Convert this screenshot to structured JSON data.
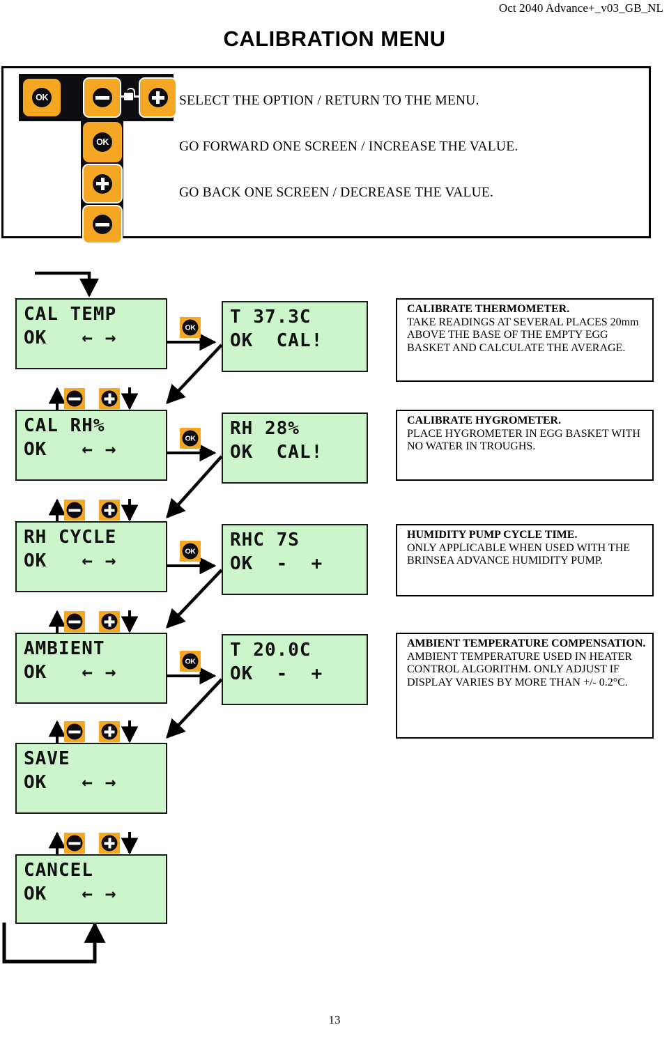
{
  "header": {
    "doc_ref": "Oct 2040 Advance+_v03_GB_NL",
    "title": "CALIBRATION MENU",
    "page_number": "13"
  },
  "legend": {
    "lines": [
      "SELECT THE OPTION / RETURN TO THE MENU.",
      "GO FORWARD ONE SCREEN / INCREASE THE VALUE.",
      "GO BACK ONE SCREEN / DECREASE THE VALUE."
    ],
    "buttons": {
      "ok_label": "OK",
      "minus_label": "-",
      "plus_label": "+",
      "lock_label": "lock"
    }
  },
  "menu_screens": [
    {
      "name": "cal-temp",
      "line1": "CAL TEMP",
      "line2": "OK   ← →"
    },
    {
      "name": "cal-rh",
      "line1": "CAL RH%",
      "line2": "OK   ← →"
    },
    {
      "name": "rh-cycle",
      "line1": "RH CYCLE",
      "line2": "OK   ← →"
    },
    {
      "name": "ambient",
      "line1": "AMBIENT",
      "line2": "OK   ← →"
    },
    {
      "name": "save",
      "line1": "SAVE",
      "line2": "OK   ← →"
    },
    {
      "name": "cancel",
      "line1": "CANCEL",
      "line2": "OK   ← →"
    }
  ],
  "value_screens": [
    {
      "name": "temp-value",
      "line1": "T 37.3C",
      "line2": "OK  CAL!"
    },
    {
      "name": "rh-value",
      "line1": "RH 28%",
      "line2": "OK  CAL!"
    },
    {
      "name": "rhc-value",
      "line1": "RHC 7S",
      "line2": "OK  -  +"
    },
    {
      "name": "ambient-value",
      "line1": "T 20.0C",
      "line2": "OK  -  +"
    }
  ],
  "descriptions": [
    {
      "name": "calibrate-thermometer",
      "title": "CALIBRATE THERMOMETER.",
      "body": "TAKE READINGS AT SEVERAL PLACES 20mm ABOVE THE BASE OF THE EMPTY EGG BASKET AND CALCULATE THE AVERAGE."
    },
    {
      "name": "calibrate-hygrometer",
      "title": "CALIBRATE HYGROMETER.",
      "body": "PLACE HYGROMETER IN EGG BASKET WITH NO WATER IN TROUGHS."
    },
    {
      "name": "humidity-pump-cycle-time",
      "title": "HUMIDITY PUMP CYCLE TIME.",
      "body": "ONLY APPLICABLE WHEN USED WITH THE BRINSEA ADVANCE HUMIDITY PUMP."
    },
    {
      "name": "ambient-temperature-compensation",
      "title": "AMBIENT TEMPERATURE COMPENSATION.",
      "body": "AMBIENT TEMPERATURE USED IN HEATER CONTROL ALGORITHM. ONLY ADJUST IF DISPLAY VARIES BY MORE THAN +/- 0.2°C."
    }
  ],
  "connectors": {
    "ok_label": "OK",
    "minus_label": "-",
    "plus_label": "+"
  },
  "colors": {
    "lcd_background": "#CCF5CC",
    "button_orange": "#F5A623",
    "keypad_black": "#0D0D12",
    "ink": "#000000"
  }
}
